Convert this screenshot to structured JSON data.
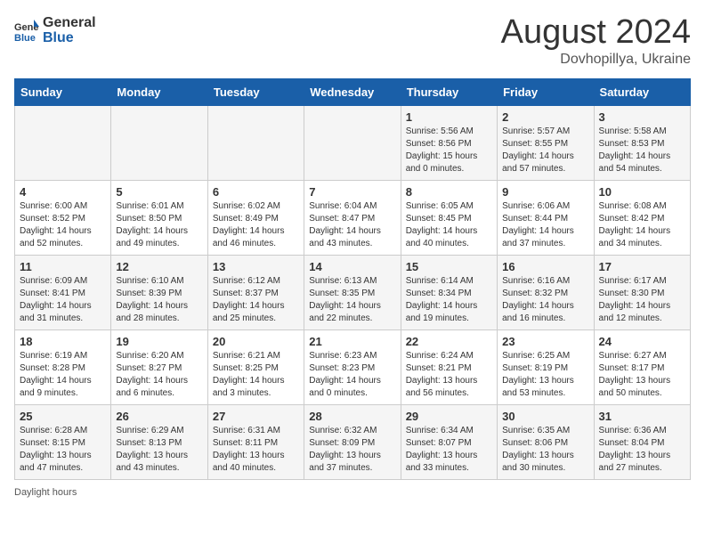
{
  "header": {
    "logo_general": "General",
    "logo_blue": "Blue",
    "month": "August 2024",
    "location": "Dovhopillya, Ukraine"
  },
  "days_of_week": [
    "Sunday",
    "Monday",
    "Tuesday",
    "Wednesday",
    "Thursday",
    "Friday",
    "Saturday"
  ],
  "weeks": [
    [
      {
        "day": "",
        "info": ""
      },
      {
        "day": "",
        "info": ""
      },
      {
        "day": "",
        "info": ""
      },
      {
        "day": "",
        "info": ""
      },
      {
        "day": "1",
        "info": "Sunrise: 5:56 AM\nSunset: 8:56 PM\nDaylight: 15 hours\nand 0 minutes."
      },
      {
        "day": "2",
        "info": "Sunrise: 5:57 AM\nSunset: 8:55 PM\nDaylight: 14 hours\nand 57 minutes."
      },
      {
        "day": "3",
        "info": "Sunrise: 5:58 AM\nSunset: 8:53 PM\nDaylight: 14 hours\nand 54 minutes."
      }
    ],
    [
      {
        "day": "4",
        "info": "Sunrise: 6:00 AM\nSunset: 8:52 PM\nDaylight: 14 hours\nand 52 minutes."
      },
      {
        "day": "5",
        "info": "Sunrise: 6:01 AM\nSunset: 8:50 PM\nDaylight: 14 hours\nand 49 minutes."
      },
      {
        "day": "6",
        "info": "Sunrise: 6:02 AM\nSunset: 8:49 PM\nDaylight: 14 hours\nand 46 minutes."
      },
      {
        "day": "7",
        "info": "Sunrise: 6:04 AM\nSunset: 8:47 PM\nDaylight: 14 hours\nand 43 minutes."
      },
      {
        "day": "8",
        "info": "Sunrise: 6:05 AM\nSunset: 8:45 PM\nDaylight: 14 hours\nand 40 minutes."
      },
      {
        "day": "9",
        "info": "Sunrise: 6:06 AM\nSunset: 8:44 PM\nDaylight: 14 hours\nand 37 minutes."
      },
      {
        "day": "10",
        "info": "Sunrise: 6:08 AM\nSunset: 8:42 PM\nDaylight: 14 hours\nand 34 minutes."
      }
    ],
    [
      {
        "day": "11",
        "info": "Sunrise: 6:09 AM\nSunset: 8:41 PM\nDaylight: 14 hours\nand 31 minutes."
      },
      {
        "day": "12",
        "info": "Sunrise: 6:10 AM\nSunset: 8:39 PM\nDaylight: 14 hours\nand 28 minutes."
      },
      {
        "day": "13",
        "info": "Sunrise: 6:12 AM\nSunset: 8:37 PM\nDaylight: 14 hours\nand 25 minutes."
      },
      {
        "day": "14",
        "info": "Sunrise: 6:13 AM\nSunset: 8:35 PM\nDaylight: 14 hours\nand 22 minutes."
      },
      {
        "day": "15",
        "info": "Sunrise: 6:14 AM\nSunset: 8:34 PM\nDaylight: 14 hours\nand 19 minutes."
      },
      {
        "day": "16",
        "info": "Sunrise: 6:16 AM\nSunset: 8:32 PM\nDaylight: 14 hours\nand 16 minutes."
      },
      {
        "day": "17",
        "info": "Sunrise: 6:17 AM\nSunset: 8:30 PM\nDaylight: 14 hours\nand 12 minutes."
      }
    ],
    [
      {
        "day": "18",
        "info": "Sunrise: 6:19 AM\nSunset: 8:28 PM\nDaylight: 14 hours\nand 9 minutes."
      },
      {
        "day": "19",
        "info": "Sunrise: 6:20 AM\nSunset: 8:27 PM\nDaylight: 14 hours\nand 6 minutes."
      },
      {
        "day": "20",
        "info": "Sunrise: 6:21 AM\nSunset: 8:25 PM\nDaylight: 14 hours\nand 3 minutes."
      },
      {
        "day": "21",
        "info": "Sunrise: 6:23 AM\nSunset: 8:23 PM\nDaylight: 14 hours\nand 0 minutes."
      },
      {
        "day": "22",
        "info": "Sunrise: 6:24 AM\nSunset: 8:21 PM\nDaylight: 13 hours\nand 56 minutes."
      },
      {
        "day": "23",
        "info": "Sunrise: 6:25 AM\nSunset: 8:19 PM\nDaylight: 13 hours\nand 53 minutes."
      },
      {
        "day": "24",
        "info": "Sunrise: 6:27 AM\nSunset: 8:17 PM\nDaylight: 13 hours\nand 50 minutes."
      }
    ],
    [
      {
        "day": "25",
        "info": "Sunrise: 6:28 AM\nSunset: 8:15 PM\nDaylight: 13 hours\nand 47 minutes."
      },
      {
        "day": "26",
        "info": "Sunrise: 6:29 AM\nSunset: 8:13 PM\nDaylight: 13 hours\nand 43 minutes."
      },
      {
        "day": "27",
        "info": "Sunrise: 6:31 AM\nSunset: 8:11 PM\nDaylight: 13 hours\nand 40 minutes."
      },
      {
        "day": "28",
        "info": "Sunrise: 6:32 AM\nSunset: 8:09 PM\nDaylight: 13 hours\nand 37 minutes."
      },
      {
        "day": "29",
        "info": "Sunrise: 6:34 AM\nSunset: 8:07 PM\nDaylight: 13 hours\nand 33 minutes."
      },
      {
        "day": "30",
        "info": "Sunrise: 6:35 AM\nSunset: 8:06 PM\nDaylight: 13 hours\nand 30 minutes."
      },
      {
        "day": "31",
        "info": "Sunrise: 6:36 AM\nSunset: 8:04 PM\nDaylight: 13 hours\nand 27 minutes."
      }
    ]
  ],
  "footer": "Daylight hours"
}
